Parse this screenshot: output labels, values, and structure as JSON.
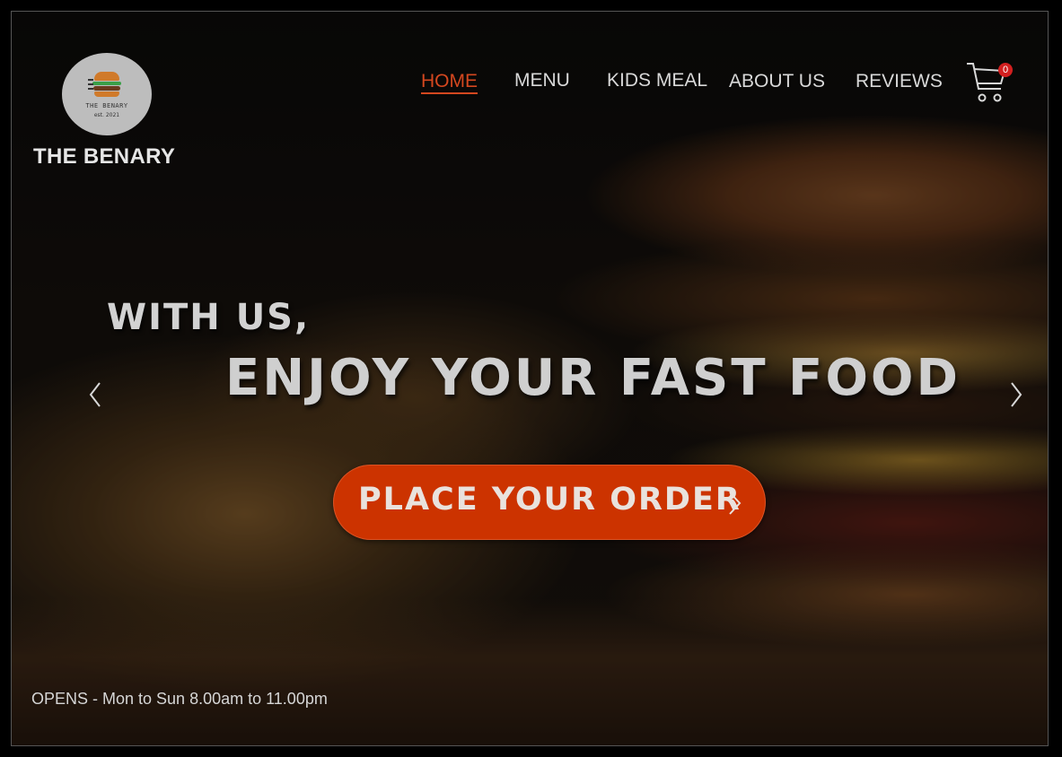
{
  "brand": {
    "logo_text": "THE BENARY",
    "logo_est": "est. 2021",
    "name": "THE BENARY"
  },
  "nav": {
    "items": [
      {
        "label": "HOME",
        "active": true
      },
      {
        "label": "MENU",
        "active": false
      },
      {
        "label": "KIDS MEAL",
        "active": false
      },
      {
        "label": "ABOUT US",
        "active": false
      },
      {
        "label": "REVIEWS",
        "active": false
      }
    ],
    "cart_icon": "cart-icon",
    "cart_count": "0"
  },
  "hero": {
    "subtitle": "WITH US,",
    "title": "ENJOY YOUR FAST FOOD",
    "prev_icon": "chevron-left-icon",
    "next_icon": "chevron-right-icon",
    "cta_label": "PLACE YOUR ORDER",
    "cta_icon": "chevron-right-icon"
  },
  "footer": {
    "hours": "OPENS - Mon to Sun 8.00am to 11.00pm"
  },
  "colors": {
    "accent": "#cc3300",
    "active_nav": "#d4471f",
    "badge": "#d31f1f",
    "text_light": "#d8d8d8"
  }
}
